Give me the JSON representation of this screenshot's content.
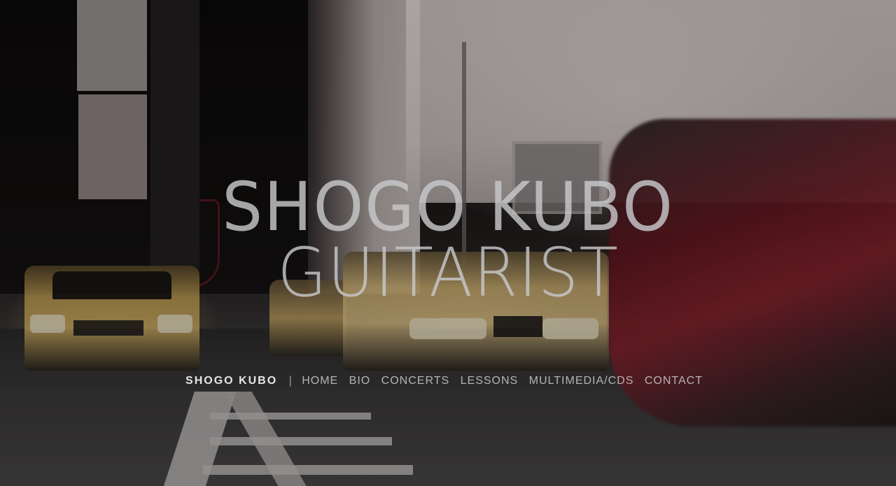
{
  "hero": {
    "title": "SHOGO KUBO",
    "subtitle": "GUITARIST"
  },
  "nav": {
    "brand": "SHOGO KUBO",
    "separator": "|",
    "items": [
      {
        "label": "HOME"
      },
      {
        "label": "BIO"
      },
      {
        "label": "CONCERTS"
      },
      {
        "label": "LESSONS"
      },
      {
        "label": "MULTIMEDIA/CDS"
      },
      {
        "label": "CONTACT"
      }
    ]
  }
}
